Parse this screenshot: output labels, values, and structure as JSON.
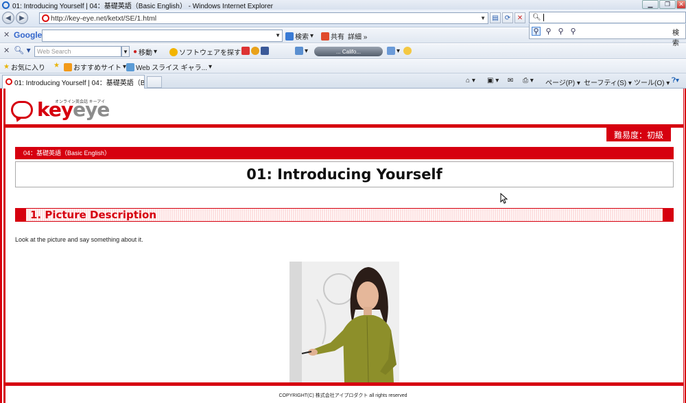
{
  "window": {
    "title": "01: Introducing Yourself | 04：基礎英語（Basic English） - Windows Internet Explorer"
  },
  "nav": {
    "url": "http://key-eye.net/ketxt/SE/1.html",
    "search_value": "",
    "search_button_label": "検索"
  },
  "google_toolbar": {
    "logo": "Google",
    "search_label": "検索",
    "share_label": "共有",
    "details_label": "詳細 »"
  },
  "web_toolbar": {
    "search_placeholder": "Web Search",
    "go_label": "移動",
    "software_label": "ソフトウェアを探す",
    "media_label": "... Califo..."
  },
  "favorites_bar": {
    "favorites_label": "お気に入り",
    "suggested_label": "おすすめサイト",
    "webslice_label": "Web スライス ギャラ..."
  },
  "tabs": {
    "active_tab": "01: Introducing Yourself | 04：基礎英語（Ba..."
  },
  "command_bar": {
    "page": "ページ(P)",
    "safety": "セーフティ(S)",
    "tools": "ツール(O)"
  },
  "site": {
    "logo_key": "key",
    "logo_eye": "eye",
    "logo_tagline": "オンライン英会話 キーアイ",
    "difficulty": "難易度：初級",
    "breadcrumb": "04：基礎英語（Basic English）",
    "lesson_title": "01: Introducing Yourself",
    "section_title": "1. Picture Description",
    "instruction": "Look at the picture and say something about it.",
    "copyright": "COPYRIGHT(C) 株式会社アイプロダクト all rights reserved"
  },
  "colors": {
    "brand_red": "#d6000f",
    "chrome_blue": "#dbe5f2"
  }
}
